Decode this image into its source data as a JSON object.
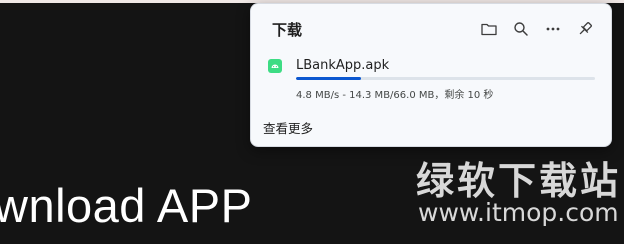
{
  "background": {
    "heading": "wnload APP",
    "watermark": {
      "name_cn": "绿软下载站",
      "url": "www.itmop.com"
    }
  },
  "downloads_panel": {
    "title": "下载",
    "icons": [
      "folder-icon",
      "search-icon",
      "more-icon",
      "pin-icon"
    ],
    "items": [
      {
        "file_name": "LBankApp.apk",
        "file_icon": "android-icon",
        "progress_fraction": 0.217,
        "status": "4.8 MB/s - 14.3 MB/66.0 MB，剩余 10 秒"
      }
    ],
    "show_more_label": "查看更多"
  },
  "colors": {
    "page_background": "#141414",
    "panel_background": "#f7f9fc",
    "progress_accent": "#0b57d0",
    "android_green": "#3ddc84"
  }
}
